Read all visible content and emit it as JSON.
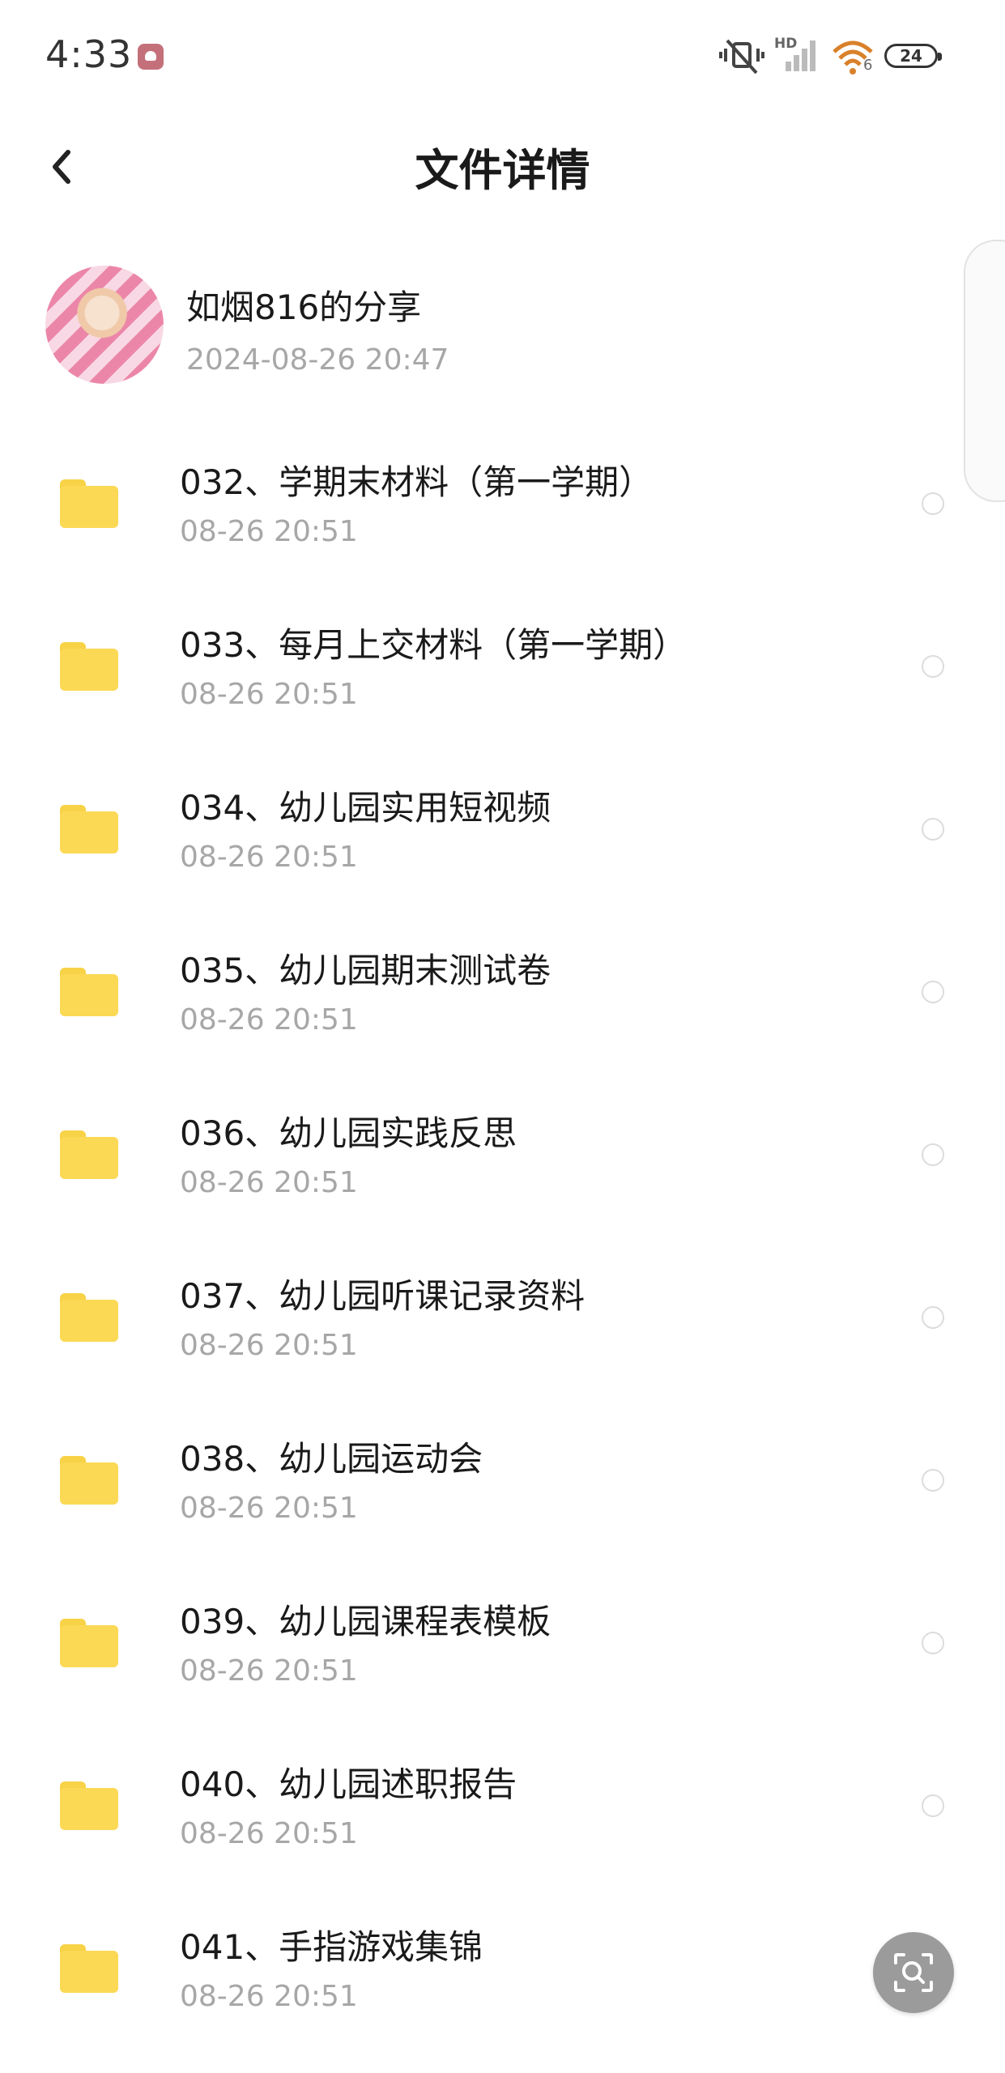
{
  "status_bar": {
    "time": "4:33",
    "battery": "24",
    "network_label": "HD",
    "wifi_sub": "6",
    "icons": [
      "notification-app-icon",
      "mute-vibrate-icon",
      "hd-signal-icon",
      "wifi-icon",
      "battery-icon"
    ]
  },
  "header": {
    "title": "文件详情",
    "back_icon": "chevron-left-icon"
  },
  "share": {
    "name": "如烟816的分享",
    "time": "2024-08-26  20:47"
  },
  "files": [
    {
      "name": "032、学期末材料（第一学期）",
      "time": "08-26  20:51"
    },
    {
      "name": "033、每月上交材料（第一学期）",
      "time": "08-26  20:51"
    },
    {
      "name": "034、幼儿园实用短视频",
      "time": "08-26  20:51"
    },
    {
      "name": "035、幼儿园期末测试卷",
      "time": "08-26  20:51"
    },
    {
      "name": "036、幼儿园实践反思",
      "time": "08-26  20:51"
    },
    {
      "name": "037、幼儿园听课记录资料",
      "time": "08-26  20:51"
    },
    {
      "name": "038、幼儿园运动会",
      "time": "08-26  20:51"
    },
    {
      "name": "039、幼儿园课程表模板",
      "time": "08-26  20:51"
    },
    {
      "name": "040、幼儿园述职报告",
      "time": "08-26  20:51"
    },
    {
      "name": "041、手指游戏集锦",
      "time": "08-26  20:51"
    }
  ],
  "colors": {
    "folder": "#fbd955",
    "secondary_text": "#a7a7a7",
    "fab": "#9b9b9b"
  },
  "fab": {
    "icon": "search-scan-icon"
  }
}
